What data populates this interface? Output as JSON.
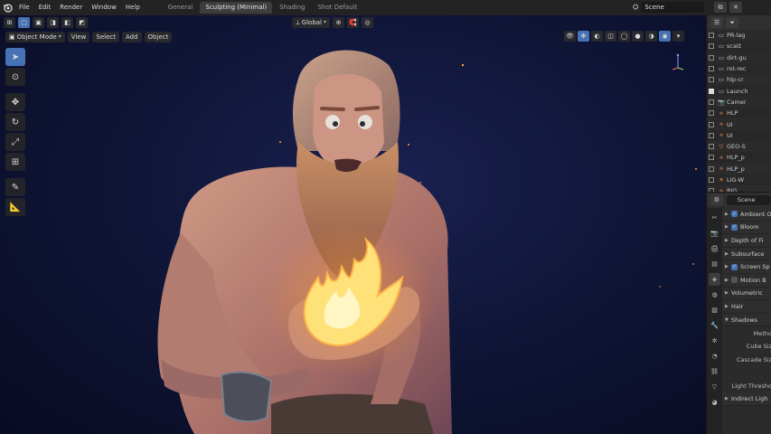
{
  "topbar": {
    "menus": [
      "File",
      "Edit",
      "Render",
      "Window",
      "Help"
    ],
    "workspaces": [
      "General",
      "Sculpting (Minimal)",
      "Shading",
      "Shot Default"
    ],
    "active_workspace": "Sculpting (Minimal)",
    "scene_name": "Scene"
  },
  "viewport": {
    "transform_orientation": "Global",
    "mode": "Object Mode",
    "menus": [
      "View",
      "Select",
      "Add",
      "Object"
    ]
  },
  "outliner": {
    "rows": [
      {
        "label": "PR-lag",
        "icon": "collection-icon",
        "checked": false
      },
      {
        "label": "scatt",
        "icon": "collection-icon",
        "checked": false
      },
      {
        "label": "dirt-gu",
        "icon": "collection-icon",
        "checked": false
      },
      {
        "label": "rot-rec",
        "icon": "collection-icon",
        "checked": false
      },
      {
        "label": "hlp-cr",
        "icon": "collection-icon",
        "checked": false
      },
      {
        "label": "Launch",
        "icon": "collection-icon",
        "checked": true
      },
      {
        "label": "Camer",
        "icon": "camera-icon",
        "checked": false
      },
      {
        "label": "HLP",
        "icon": "armature-icon",
        "checked": false
      },
      {
        "label": "UI",
        "icon": "armature-icon",
        "checked": false
      },
      {
        "label": "UI",
        "icon": "armature-icon",
        "checked": false
      },
      {
        "label": "GEO-S",
        "icon": "mesh-icon",
        "checked": false
      },
      {
        "label": "HLP_p",
        "icon": "armature-icon",
        "checked": false
      },
      {
        "label": "HLP_p",
        "icon": "armature-icon",
        "checked": false
      },
      {
        "label": "LIG-W",
        "icon": "light-icon",
        "checked": false
      },
      {
        "label": "RIG",
        "icon": "armature-icon",
        "checked": false
      }
    ]
  },
  "properties": {
    "search_value": "Scene",
    "sections": [
      {
        "label": "Ambient O",
        "checkbox": true,
        "checked": true,
        "kind": "panel"
      },
      {
        "label": "Bloom",
        "checkbox": true,
        "checked": true,
        "kind": "panel"
      },
      {
        "label": "Depth of Fi",
        "checkbox": false,
        "checked": false,
        "kind": "panel"
      },
      {
        "label": "Subsurface",
        "checkbox": false,
        "checked": false,
        "kind": "panel"
      },
      {
        "label": "Screen Sp",
        "checkbox": true,
        "checked": true,
        "kind": "panel"
      },
      {
        "label": "Motion B",
        "checkbox": true,
        "checked": false,
        "kind": "panel"
      },
      {
        "label": "Volumetric",
        "checkbox": false,
        "checked": false,
        "kind": "panel"
      },
      {
        "label": "Hair",
        "checkbox": false,
        "checked": false,
        "kind": "panel"
      },
      {
        "label": "Shadows",
        "checkbox": false,
        "checked": false,
        "kind": "panel-open"
      },
      {
        "label": "Metho",
        "kind": "field"
      },
      {
        "label": "Cube Siz",
        "kind": "field"
      },
      {
        "label": "Cascade Siz",
        "kind": "field"
      },
      {
        "label": "",
        "kind": "blank"
      },
      {
        "label": "Light Thresho",
        "kind": "field"
      },
      {
        "label": "Indirect Ligh",
        "checkbox": false,
        "checked": false,
        "kind": "panel"
      }
    ]
  },
  "colors": {
    "accent": "#4772b3",
    "viewport_bg": "#101638",
    "fire": "#ffd65a"
  }
}
